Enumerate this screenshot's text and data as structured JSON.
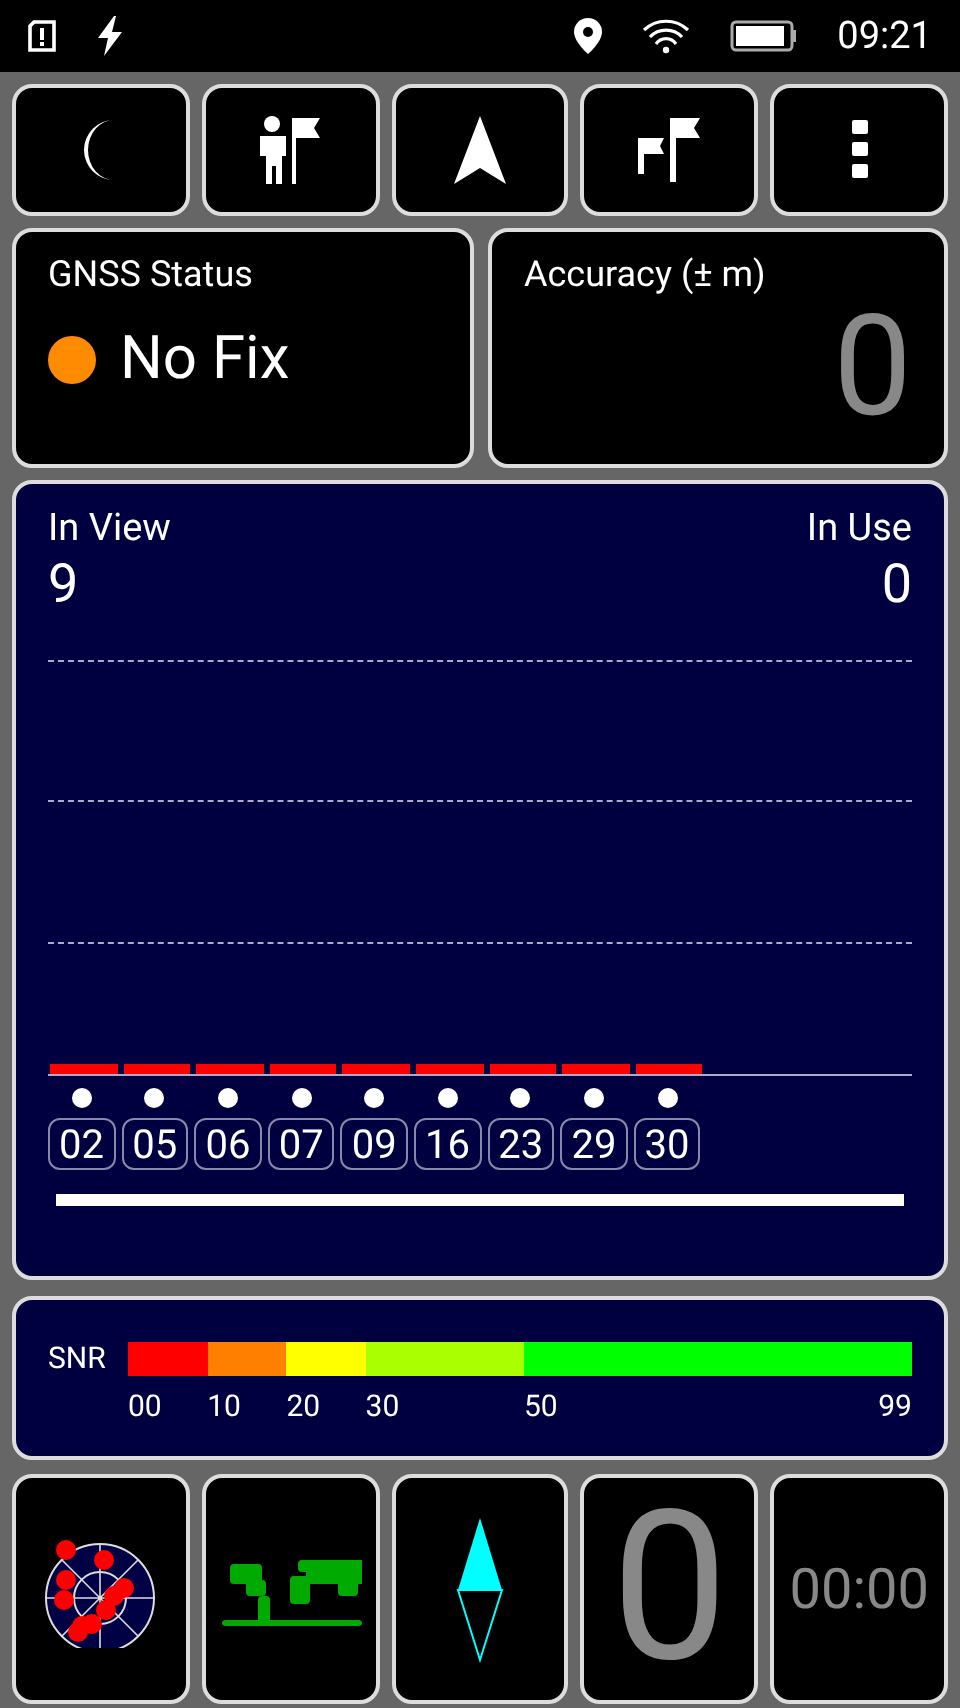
{
  "status_bar": {
    "time": "09:21"
  },
  "toolbar": {
    "buttons": [
      {
        "kind": "night"
      },
      {
        "kind": "person-flag"
      },
      {
        "kind": "navigate"
      },
      {
        "kind": "flags"
      },
      {
        "kind": "more"
      }
    ]
  },
  "gnss_status": {
    "title": "GNSS Status",
    "value": "No Fix",
    "color": "#ff8c00"
  },
  "accuracy": {
    "title": "Accuracy (± m)",
    "value": "0"
  },
  "satellites": {
    "in_view_label": "In View",
    "in_view": "9",
    "in_use_label": "In Use",
    "in_use": "0",
    "items": [
      {
        "prn": "02",
        "color": "#ff0000"
      },
      {
        "prn": "05",
        "color": "#ff0000"
      },
      {
        "prn": "06",
        "color": "#ff0000"
      },
      {
        "prn": "07",
        "color": "#ff0000"
      },
      {
        "prn": "09",
        "color": "#ff0000"
      },
      {
        "prn": "16",
        "color": "#ff0000"
      },
      {
        "prn": "23",
        "color": "#ff0000"
      },
      {
        "prn": "29",
        "color": "#ff0000"
      },
      {
        "prn": "30",
        "color": "#ff0000"
      }
    ]
  },
  "snr_legend": {
    "label": "SNR",
    "ticks": [
      "00",
      "10",
      "20",
      "30",
      "50",
      "99"
    ],
    "segments": [
      {
        "color": "#ff0000"
      },
      {
        "color": "#ff8000"
      },
      {
        "color": "#ffff00"
      },
      {
        "color": "#aaff00"
      },
      {
        "color": "#00ff00"
      }
    ]
  },
  "bottom_tiles": [
    {
      "kind": "radar"
    },
    {
      "kind": "map"
    },
    {
      "kind": "compass"
    },
    {
      "kind": "number",
      "value": "0"
    },
    {
      "kind": "timer",
      "value": "00:00"
    }
  ]
}
